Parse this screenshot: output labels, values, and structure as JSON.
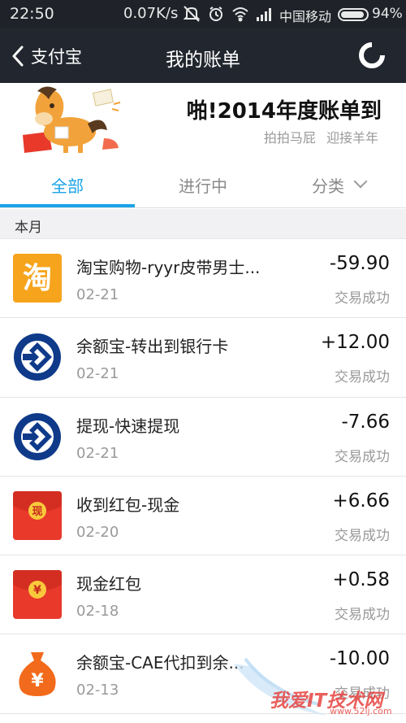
{
  "status_bar": {
    "time": "22:50",
    "speed": "0.07K/s",
    "carrier": "中国移动",
    "battery": "94%"
  },
  "nav": {
    "back_label": "支付宝",
    "title": "我的账单"
  },
  "banner": {
    "title": "啪!2014年度账单到",
    "subtitle": "拍拍马屁 迎接羊年"
  },
  "tabs": [
    {
      "label": "全部"
    },
    {
      "label": "进行中"
    },
    {
      "label": "分类"
    }
  ],
  "section_label": "本月",
  "transactions": [
    {
      "icon": "taobao-icon",
      "title": "淘宝购物-ryyr皮带男士...",
      "date": "02-21",
      "amount": "-59.90",
      "status": "交易成功"
    },
    {
      "icon": "ccb-bank-icon",
      "title": "余额宝-转出到银行卡",
      "date": "02-21",
      "amount": "+12.00",
      "status": "交易成功"
    },
    {
      "icon": "ccb-bank-icon",
      "title": "提现-快速提现",
      "date": "02-21",
      "amount": "-7.66",
      "status": "交易成功"
    },
    {
      "icon": "red-envelope-cash-icon",
      "title": "收到红包-现金",
      "date": "02-20",
      "amount": "+6.66",
      "status": "交易成功"
    },
    {
      "icon": "red-envelope-yuan-icon",
      "title": "现金红包",
      "date": "02-18",
      "amount": "+0.58",
      "status": "交易成功"
    },
    {
      "icon": "money-bag-icon",
      "title": "余额宝-CAE代扣到余...",
      "date": "02-13",
      "amount": "-10.00",
      "status": "交易成功"
    }
  ],
  "icon_glyphs": {
    "taobao": "淘",
    "cash": "现",
    "yuan": "¥"
  },
  "watermark": {
    "text": "我爱IT技术网",
    "url": "www.52ij.com"
  },
  "colors": {
    "accent": "#1aa3e8",
    "nav_bg": "#22262e",
    "taobao_orange": "#f7a41d",
    "ccb_blue": "#0f3a8a",
    "envelope_red": "#e8392b"
  }
}
